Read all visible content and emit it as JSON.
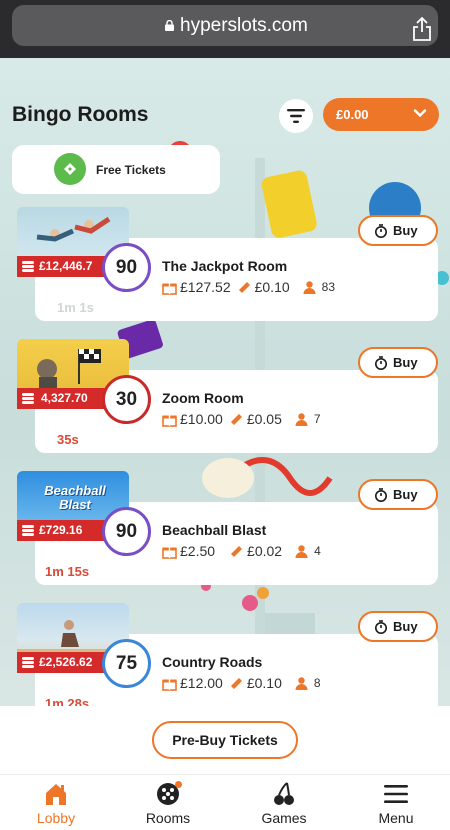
{
  "browser": {
    "url": "hyperslots.com"
  },
  "header": {
    "title": "Bingo Rooms",
    "balance": "£0.00"
  },
  "free_tickets": {
    "label": "Free Tickets"
  },
  "rooms": [
    {
      "name": "The Jackpot Room",
      "ball": "90",
      "jackpot": "£12,446.7",
      "prize": "£127.52",
      "ticket": "£0.10",
      "players": "83",
      "timer": "1m 1s",
      "buy": "Buy"
    },
    {
      "name": "Zoom Room",
      "ball": "30",
      "jackpot": "4,327.70",
      "prize": "£10.00",
      "ticket": "£0.05",
      "players": "7",
      "timer": "35s",
      "buy": "Buy"
    },
    {
      "name": "Beachball Blast",
      "ball": "90",
      "jackpot": "£729.16",
      "prize": "£2.50",
      "ticket": "£0.02",
      "players": "4",
      "timer": "1m 15s",
      "buy": "Buy",
      "thumb_title": "Beachball Blast"
    },
    {
      "name": "Country Roads",
      "ball": "75",
      "jackpot": "£2,526.62",
      "prize": "£12.00",
      "ticket": "£0.10",
      "players": "8",
      "timer": "1m 28s",
      "buy": "Buy"
    }
  ],
  "prebuy": {
    "label": "Pre-Buy Tickets"
  },
  "nav": [
    {
      "label": "Lobby",
      "icon": "home-icon"
    },
    {
      "label": "Rooms",
      "icon": "bingo-ball-icon"
    },
    {
      "label": "Games",
      "icon": "cherries-icon"
    },
    {
      "label": "Menu",
      "icon": "hamburger-icon"
    }
  ],
  "colors": {
    "accent": "#ee7628",
    "jackpot": "#d42a2a",
    "timer": "#dc4a36",
    "free_ticket_icon": "#5cbb4a"
  }
}
